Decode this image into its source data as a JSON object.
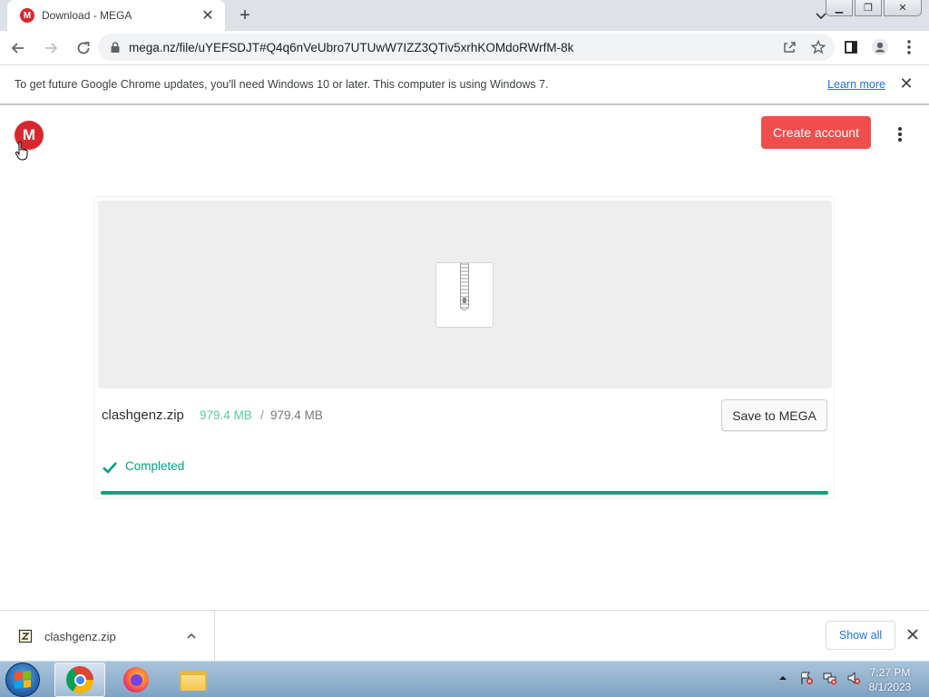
{
  "browser": {
    "tab_title": "Download - MEGA",
    "favicon_letter": "M",
    "url": "mega.nz/file/uYEFSDJT#Q4q6nVeUbro7UTUwW7IZZ3QTiv5xrhKOMdoRWrfM-8k"
  },
  "infobar": {
    "message": "To get future Google Chrome updates, you'll need Windows 10 or later. This computer is using Windows 7.",
    "link": "Learn more"
  },
  "page": {
    "logo_letter": "M",
    "create_account": "Create account",
    "file_name": "clashgenz.zip",
    "size_downloaded": "979.4 MB",
    "size_separator": "/",
    "size_total": "979.4 MB",
    "save_button": "Save to MEGA",
    "status": "Completed",
    "progress_fraction": 1.0
  },
  "shelf": {
    "file_name": "clashgenz.zip",
    "show_all": "Show all"
  },
  "taskbar": {
    "time": "7:27 PM",
    "date": "8/1/2023",
    "apps": [
      "chrome-icon",
      "firefox-icon",
      "file-explorer-icon"
    ]
  },
  "colors": {
    "mega_red": "#d9272e",
    "create_button": "#f04d4d",
    "progress": "#13a07c",
    "downloaded_size": "#56c9a8",
    "status_green": "#00a382",
    "link_blue": "#1a73e8"
  }
}
